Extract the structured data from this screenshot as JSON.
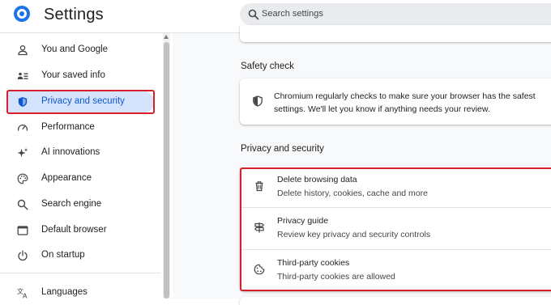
{
  "header": {
    "title": "Settings",
    "search_placeholder": "Search settings"
  },
  "sidebar": {
    "items": [
      {
        "label": "You and Google",
        "icon": "person-icon"
      },
      {
        "label": "Your saved info",
        "icon": "saved-info-icon"
      },
      {
        "label": "Privacy and security",
        "icon": "shield-icon",
        "active": true
      },
      {
        "label": "Performance",
        "icon": "speedometer-icon"
      },
      {
        "label": "AI innovations",
        "icon": "sparkle-icon"
      },
      {
        "label": "Appearance",
        "icon": "palette-icon"
      },
      {
        "label": "Search engine",
        "icon": "search-icon"
      },
      {
        "label": "Default browser",
        "icon": "browser-window-icon"
      },
      {
        "label": "On startup",
        "icon": "power-icon"
      },
      {
        "label": "Languages",
        "icon": "translate-icon"
      }
    ]
  },
  "main": {
    "safety_check": {
      "title": "Safety check",
      "text_line1": "Chromium regularly checks to make sure your browser has the safest",
      "text_line2": "settings. We'll let you know if anything needs your review."
    },
    "privacy": {
      "title": "Privacy and security",
      "rows": [
        {
          "title": "Delete browsing data",
          "subtitle": "Delete history, cookies, cache and more",
          "icon": "trash-icon"
        },
        {
          "title": "Privacy guide",
          "subtitle": "Review key privacy and security controls",
          "icon": "signpost-icon"
        },
        {
          "title": "Third-party cookies",
          "subtitle": "Third-party cookies are allowed",
          "icon": "cookie-icon"
        }
      ]
    }
  },
  "colors": {
    "accent": "#0b57d0",
    "active_bg": "#d6e3fc",
    "annotation": "#d7202a"
  }
}
